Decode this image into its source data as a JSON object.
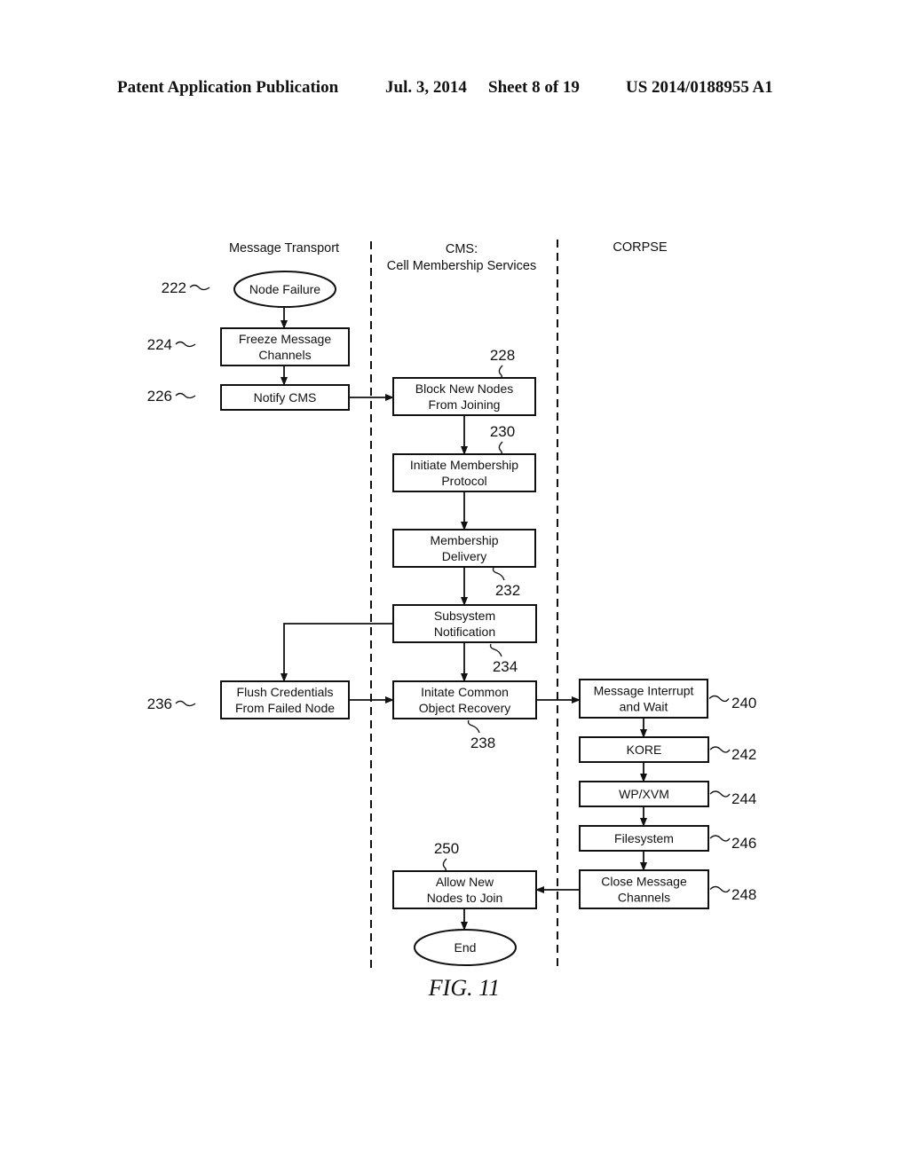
{
  "header": {
    "left": "Patent Application Publication",
    "date": "Jul. 3, 2014",
    "sheet": "Sheet 8 of 19",
    "number": "US 2014/0188955 A1"
  },
  "lanes": [
    {
      "id": "transport",
      "label": [
        "Message Transport"
      ]
    },
    {
      "id": "cms",
      "label": [
        "CMS:",
        "Cell Membership Services"
      ]
    },
    {
      "id": "corpse",
      "label": [
        "CORPSE"
      ]
    }
  ],
  "nodes": [
    {
      "id": "n222",
      "ref": "222",
      "shape": "ellipse",
      "lane": "transport",
      "lines": [
        "Node Failure"
      ]
    },
    {
      "id": "n224",
      "ref": "224",
      "shape": "box",
      "lane": "transport",
      "lines": [
        "Freeze Message",
        "Channels"
      ]
    },
    {
      "id": "n226",
      "ref": "226",
      "shape": "box",
      "lane": "transport",
      "lines": [
        "Notify CMS"
      ]
    },
    {
      "id": "n228",
      "ref": "228",
      "shape": "box",
      "lane": "cms",
      "lines": [
        "Block New Nodes",
        "From Joining"
      ]
    },
    {
      "id": "n230",
      "ref": "230",
      "shape": "box",
      "lane": "cms",
      "lines": [
        "Initiate Membership",
        "Protocol"
      ]
    },
    {
      "id": "n232",
      "ref": "232",
      "shape": "box",
      "lane": "cms",
      "lines": [
        "Membership",
        "Delivery"
      ]
    },
    {
      "id": "n234",
      "ref": "234",
      "shape": "box",
      "lane": "cms",
      "lines": [
        "Subsystem",
        "Notification"
      ]
    },
    {
      "id": "n236",
      "ref": "236",
      "shape": "box",
      "lane": "transport",
      "lines": [
        "Flush Credentials",
        "From Failed Node"
      ]
    },
    {
      "id": "n238",
      "ref": "238",
      "shape": "box",
      "lane": "cms",
      "lines": [
        "Initate Common",
        "Object Recovery"
      ]
    },
    {
      "id": "n240",
      "ref": "240",
      "shape": "box",
      "lane": "corpse",
      "lines": [
        "Message Interrupt",
        "and Wait"
      ]
    },
    {
      "id": "n242",
      "ref": "242",
      "shape": "box",
      "lane": "corpse",
      "lines": [
        "KORE"
      ]
    },
    {
      "id": "n244",
      "ref": "244",
      "shape": "box",
      "lane": "corpse",
      "lines": [
        "WP/XVM"
      ]
    },
    {
      "id": "n246",
      "ref": "246",
      "shape": "box",
      "lane": "corpse",
      "lines": [
        "Filesystem"
      ]
    },
    {
      "id": "n248",
      "ref": "248",
      "shape": "box",
      "lane": "corpse",
      "lines": [
        "Close Message",
        "Channels"
      ]
    },
    {
      "id": "n250",
      "ref": "250",
      "shape": "box",
      "lane": "cms",
      "lines": [
        "Allow New",
        "Nodes to Join"
      ]
    },
    {
      "id": "end",
      "ref": "",
      "shape": "ellipse",
      "lane": "cms",
      "lines": [
        "End"
      ]
    }
  ],
  "edges": [
    {
      "from": "n222",
      "to": "n224"
    },
    {
      "from": "n224",
      "to": "n226"
    },
    {
      "from": "n226",
      "to": "n228"
    },
    {
      "from": "n228",
      "to": "n230"
    },
    {
      "from": "n230",
      "to": "n232"
    },
    {
      "from": "n232",
      "to": "n234"
    },
    {
      "from": "n234",
      "to": "n236"
    },
    {
      "from": "n234",
      "to": "n238"
    },
    {
      "from": "n236",
      "to": "n238"
    },
    {
      "from": "n238",
      "to": "n240"
    },
    {
      "from": "n240",
      "to": "n242"
    },
    {
      "from": "n242",
      "to": "n244"
    },
    {
      "from": "n244",
      "to": "n246"
    },
    {
      "from": "n246",
      "to": "n248"
    },
    {
      "from": "n248",
      "to": "n250"
    },
    {
      "from": "n250",
      "to": "end"
    }
  ],
  "figure_label": "FIG. 11"
}
